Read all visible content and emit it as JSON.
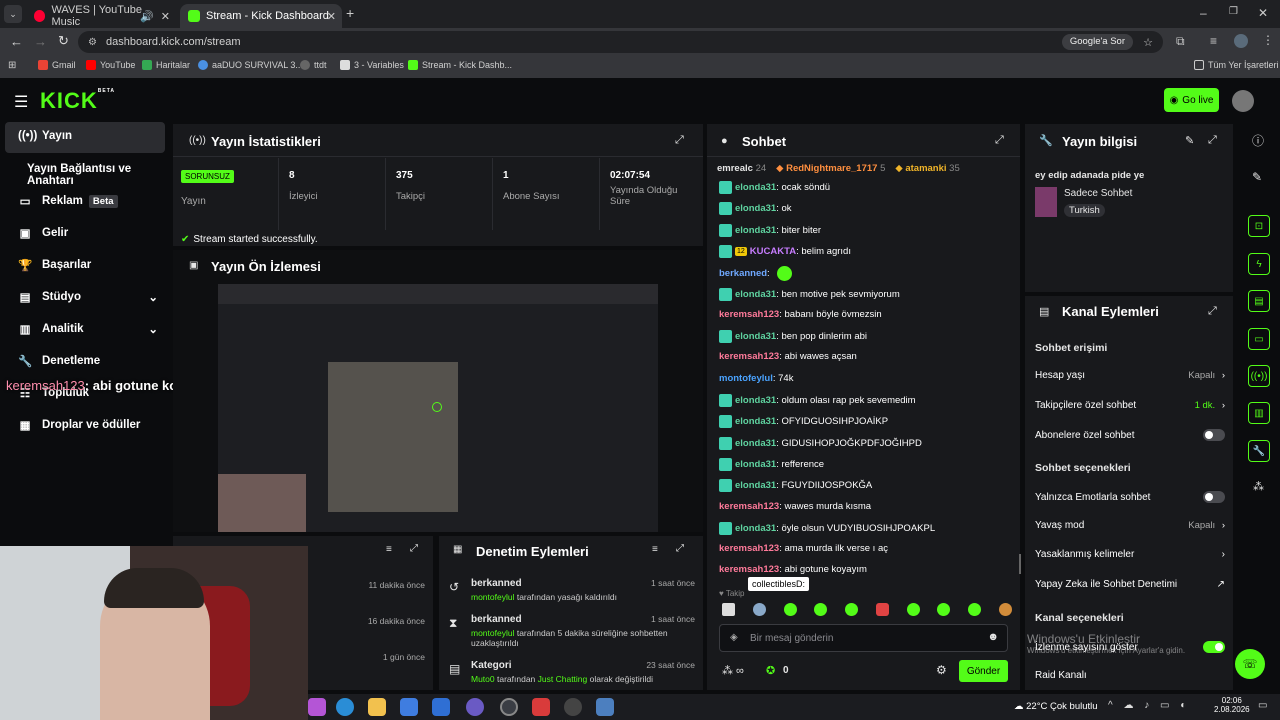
{
  "browser": {
    "tabs": [
      {
        "label": "WAVES | YouTube Music"
      },
      {
        "label": "Stream - Kick Dashboard"
      }
    ],
    "url": "dashboard.kick.com/stream",
    "search_chip": "Google'a Sor",
    "bookmarks": [
      "Gmail",
      "YouTube",
      "Haritalar",
      "aaDUO SURVIVAL 3...",
      "ttdt",
      "3 - Variables",
      "Stream - Kick Dashb..."
    ],
    "all_bookmarks": "Tüm Yer İşaretleri"
  },
  "header": {
    "logo": "KICK",
    "logo_beta": "BETA",
    "go_live": "Go live"
  },
  "sidebar": {
    "items": [
      {
        "label": "Yayın"
      },
      {
        "label": "Yayın Bağlantısı ve Anahtarı"
      },
      {
        "label": "Reklam",
        "badge": "Beta"
      },
      {
        "label": "Gelir"
      },
      {
        "label": "Başarılar"
      },
      {
        "label": "Stüdyo"
      },
      {
        "label": "Analitik"
      },
      {
        "label": "Denetleme"
      },
      {
        "label": "Topluluk"
      },
      {
        "label": "Droplar ve ödüller"
      }
    ]
  },
  "overlay_chat": {
    "user": "keremsah123",
    "message": ": abi gotune koyayım"
  },
  "stats": {
    "title": "Yayın İstatistikleri",
    "status_badge": "SORUNSUZ",
    "status_label": "Yayın",
    "cells": [
      {
        "value": "8",
        "label": "İzleyici"
      },
      {
        "value": "375",
        "label": "Takipçi"
      },
      {
        "value": "1",
        "label": "Abone Sayısı"
      },
      {
        "value": "02:07:54",
        "label": "Yayında Olduğu Süre"
      }
    ],
    "success": "Stream started successfully."
  },
  "preview": {
    "title": "Yayın Ön İzlemesi"
  },
  "activity": {
    "times": [
      "11 dakika önce",
      "16 dakika önce",
      "1 gün önce"
    ]
  },
  "moderation": {
    "title": "Denetim Eylemleri",
    "items": [
      {
        "user": "berkanned",
        "time": "1 saat önce",
        "actor": "montofeylul",
        "desc": "tarafından yasağı kaldırıldı"
      },
      {
        "user": "berkanned",
        "time": "1 saat önce",
        "actor": "montofeylul",
        "desc": "tarafından 5 dakika süreliğine sohbetten uzaklaştırıldı"
      },
      {
        "user": "Kategori",
        "time": "23 saat önce",
        "actor": "Muto0",
        "desc": "tarafından",
        "extra": "Just Chatting",
        "tail": "olarak değiştirildi"
      }
    ]
  },
  "chat": {
    "title": "Sohbet",
    "top_gifters": [
      {
        "name": "emrealc",
        "count": "24"
      },
      {
        "name": "RedNightmare_1717",
        "count": "5"
      },
      {
        "name": "atamanki",
        "count": "35"
      }
    ],
    "messages": [
      {
        "user": "elonda31",
        "text": ": ocak söndü",
        "color": "#5fd3a0"
      },
      {
        "user": "elonda31",
        "text": ": ok",
        "color": "#5fd3a0"
      },
      {
        "user": "elonda31",
        "text": ": biter biter",
        "color": "#5fd3a0"
      },
      {
        "user": "KUCAKTA",
        "text": ": belim agrıdı",
        "color": "#c77dff",
        "sub": "12"
      },
      {
        "user": "berkanned",
        "text": ":",
        "color": "#6fa8ff",
        "emote": true
      },
      {
        "user": "elonda31",
        "text": ": ben motive pek sevmiyorum",
        "color": "#5fd3a0"
      },
      {
        "user": "keremsah123",
        "text": ": babanı böyle övmezsin",
        "color": "#ff7a9a"
      },
      {
        "user": "elonda31",
        "text": ": ben pop dinlerim abi",
        "color": "#5fd3a0"
      },
      {
        "user": "keremsah123",
        "text": ": abi wawes açsan",
        "color": "#ff7a9a"
      },
      {
        "user": "montofeylul",
        "text": ": 74k",
        "color": "#4aa3ff"
      },
      {
        "user": "elonda31",
        "text": ": oldum olası rap pek sevemedim",
        "color": "#5fd3a0"
      },
      {
        "user": "elonda31",
        "text": ": OFYIDGUOSIHPJOAİKP",
        "color": "#5fd3a0"
      },
      {
        "user": "elonda31",
        "text": ": GIDUSIHOPJOĞKPDFJOĞIHPD",
        "color": "#5fd3a0"
      },
      {
        "user": "elonda31",
        "text": ": refference",
        "color": "#5fd3a0"
      },
      {
        "user": "elonda31",
        "text": ": FGUYDIIJOSPOKĞA",
        "color": "#5fd3a0"
      },
      {
        "user": "keremsah123",
        "text": ": wawes murda kısma",
        "color": "#ff7a9a"
      },
      {
        "user": "elonda31",
        "text": ": öyle olsun VUDYIBUOSIHJPOAKPL",
        "color": "#5fd3a0"
      },
      {
        "user": "keremsah123",
        "text": ": ama murda ilk verse ı aç",
        "color": "#ff7a9a"
      },
      {
        "user": "keremsah123",
        "text": ": abi gotune koyayım",
        "color": "#ff7a9a"
      }
    ],
    "tooltip": "collectiblesD:",
    "follow_hint": "Takip",
    "input_placeholder": "Bir mesaj gönderin",
    "points": "0",
    "send": "Gönder"
  },
  "info": {
    "title": "Yayın bilgisi",
    "stream_title": "ey edip adanada pide ye",
    "category": "Sadece Sohbet",
    "tag": "Turkish"
  },
  "channel": {
    "title": "Kanal Eylemleri",
    "chat_access": "Sohbet erişimi",
    "rows1": [
      {
        "label": "Hesap yaşı",
        "value": "Kapalı"
      },
      {
        "label": "Takipçilere özel sohbet",
        "value": "1 dk."
      },
      {
        "label": "Abonelere özel sohbet",
        "value": ""
      }
    ],
    "chat_options": "Sohbet seçenekleri",
    "rows2": [
      {
        "label": "Yalnızca Emotlarla sohbet",
        "value": ""
      },
      {
        "label": "Yavaş mod",
        "value": "Kapalı"
      },
      {
        "label": "Yasaklanmış kelimeler",
        "value": ""
      },
      {
        "label": "Yapay Zeka ile Sohbet Denetimi",
        "value": ""
      }
    ],
    "channel_options": "Kanal seçenekleri",
    "rows3": [
      {
        "label": "İzlenme sayısını göster",
        "value": ""
      },
      {
        "label": "Raid Kanalı",
        "value": ""
      }
    ]
  },
  "windows": {
    "activate": "Windows'u Etkinleştir",
    "activate_sub": "Windows'u etkinleştirmek için Ayarlar'a gidin.",
    "weather": "22°C  Çok bulutlu",
    "time": "02:06",
    "date": "2.08.2026"
  },
  "colors": {
    "accent": "#53fc18",
    "panel": "#18191c",
    "bg": "#0b0c0e"
  }
}
